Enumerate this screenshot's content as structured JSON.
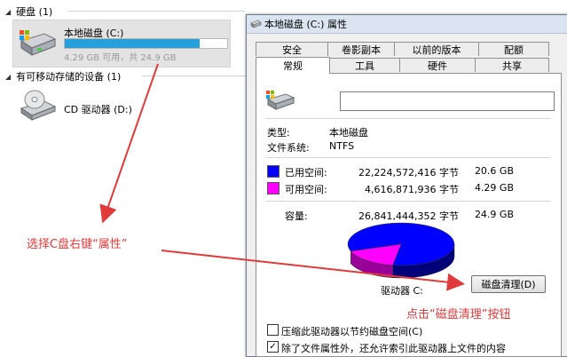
{
  "explorer": {
    "hard_disk_group": "硬盘 (1)",
    "removable_group": "有可移动存储的设备 (1)",
    "local_disk": {
      "name": "本地磁盘 (C:)",
      "info": "4.29 GB 可用，共 24.9 GB",
      "used_fraction": 0.828
    },
    "cd_drive": {
      "name": "CD 驱动器 (D:)"
    }
  },
  "dialog": {
    "title": "本地磁盘 (C:) 属性",
    "tabs_back": [
      "安全",
      "卷影副本",
      "以前的版本",
      "配额"
    ],
    "tabs_front": [
      "常规",
      "工具",
      "硬件",
      "共享"
    ],
    "active_tab": "常规",
    "general": {
      "name_value": "",
      "type_label": "类型:",
      "type_value": "本地磁盘",
      "fs_label": "文件系统:",
      "fs_value": "NTFS",
      "used": {
        "label": "已用空间:",
        "bytes": "22,224,572,416 字节",
        "size": "20.6 GB",
        "color": "#0000ff"
      },
      "free": {
        "label": "可用空间:",
        "bytes": "4,616,871,936 字节",
        "size": "4.29 GB",
        "color": "#ff00ff"
      },
      "capacity": {
        "label": "容量:",
        "bytes": "26,841,444,352 字节",
        "size": "24.9 GB"
      },
      "drive_label": "驱动器 C:",
      "cleanup_button": "磁盘清理(D)",
      "compress_checkbox": "压缩此驱动器以节约磁盘空间(C)",
      "compress_checked": false,
      "index_checkbox": "除了文件属性外，还允许索引此驱动器上文件的内容",
      "index_checked": true
    }
  },
  "annotations": {
    "right_click": "选择C盘右键“属性”",
    "click_cleanup": "点击“磁盘清理”按钮",
    "arrow_color": "#e03b3b"
  }
}
